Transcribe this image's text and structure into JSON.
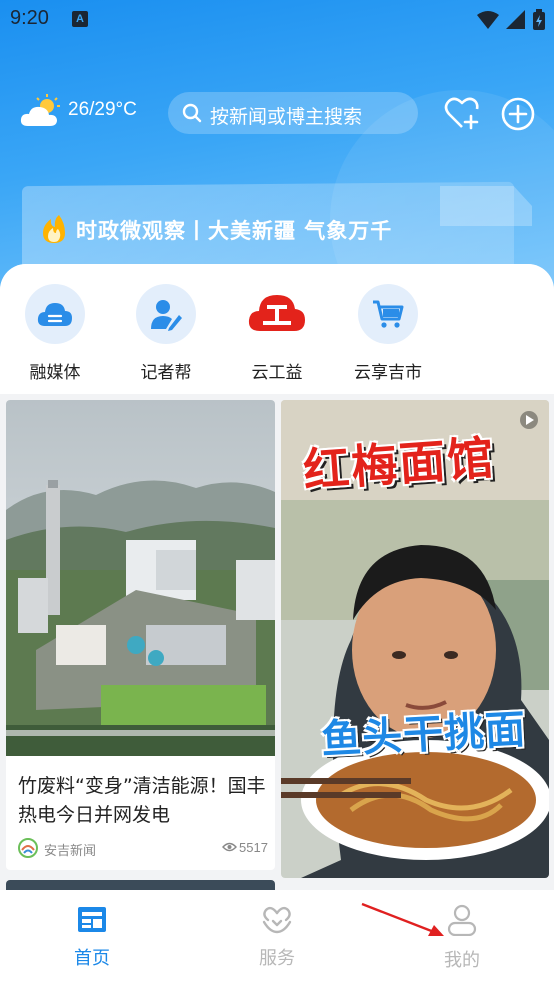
{
  "status_bar": {
    "time": "9:20",
    "notification_letter": "A"
  },
  "header": {
    "temperature": "26/29°C",
    "search_placeholder": "按新闻或博主搜索",
    "weather_icon": "partly-cloudy-icon",
    "heart_icon": "heart-plus-icon",
    "add_icon": "plus-circle-icon"
  },
  "headline": {
    "text": "时政微观察丨大美新疆 气象万千"
  },
  "quick_links": [
    {
      "label": "融媒体",
      "icon": "cloud-chat-icon"
    },
    {
      "label": "记者帮",
      "icon": "reporter-icon"
    },
    {
      "label": "云工益",
      "icon": "yun-gongyi-logo"
    },
    {
      "label": "云享吉市",
      "icon": "shopping-cart-icon"
    }
  ],
  "feed": {
    "left_card": {
      "title": "竹废料“变身”清洁能源！国丰热电今日并网发电",
      "source": "安吉新闻",
      "views": "5517"
    },
    "right_card": {
      "overlay_title": "红梅面馆",
      "overlay_subtitle": "鱼头干挑面"
    }
  },
  "bottom_nav": [
    {
      "label": "首页",
      "icon": "news-icon",
      "active": true
    },
    {
      "label": "服务",
      "icon": "service-heart-icon",
      "active": false
    },
    {
      "label": "我的",
      "icon": "user-icon",
      "active": false
    }
  ],
  "colors": {
    "accent": "#1b88e8",
    "header_top": "#1a8ff0",
    "inactive": "#b7b7b7"
  }
}
